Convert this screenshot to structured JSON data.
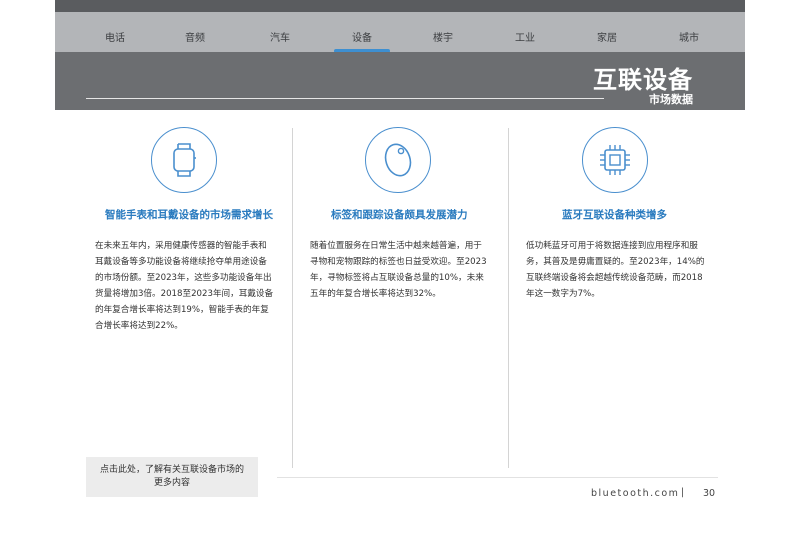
{
  "nav": {
    "items": [
      "电话",
      "音频",
      "汽车",
      "设备",
      "楼宇",
      "工业",
      "家居",
      "城市"
    ],
    "active_index": 3
  },
  "header": {
    "title": "互联设备",
    "subtitle": "市场数据"
  },
  "columns": [
    {
      "icon": "smartwatch-icon",
      "title": "智能手表和耳戴设备的市场需求增长",
      "lines": [
        "在未来五年内，采用健康传感器的智能手表和",
        "耳戴设备等多功能设备将继续抢夺单用途设备",
        "的市场份额。至2023年，这些多功能设备年出",
        "货量将增加3倍。2018至2023年间，耳戴设备",
        "的年复合增长率将达到19%，智能手表的年复",
        "合增长率将达到22%。"
      ]
    },
    {
      "icon": "tracker-tag-icon",
      "title": "标签和跟踪设备颇具发展潜力",
      "lines": [
        "随着位置服务在日常生活中越来越普遍，用于",
        "寻物和宠物跟踪的标签也日益受欢迎。至2023",
        "年，寻物标签将占互联设备总量的10%，未来",
        "五年的年复合增长率将达到32%。"
      ]
    },
    {
      "icon": "chip-icon",
      "title": "蓝牙互联设备种类增多",
      "lines": [
        "低功耗蓝牙可用于将数据连接到应用程序和服",
        "务，其普及是毋庸置疑的。至2023年，14%的",
        "互联终端设备将会超越传统设备范畴，而2018",
        "年这一数字为7%。"
      ]
    }
  ],
  "more": {
    "line1": "点击此处，了解有关互联设备市场的",
    "line2": "更多内容"
  },
  "footer": {
    "site": "bluetooth.com",
    "separator": "|",
    "page": "30"
  },
  "colors": {
    "accent": "#2a7bbf",
    "nav_bg": "#b3b5b8",
    "header_bg": "#6c6e71"
  }
}
